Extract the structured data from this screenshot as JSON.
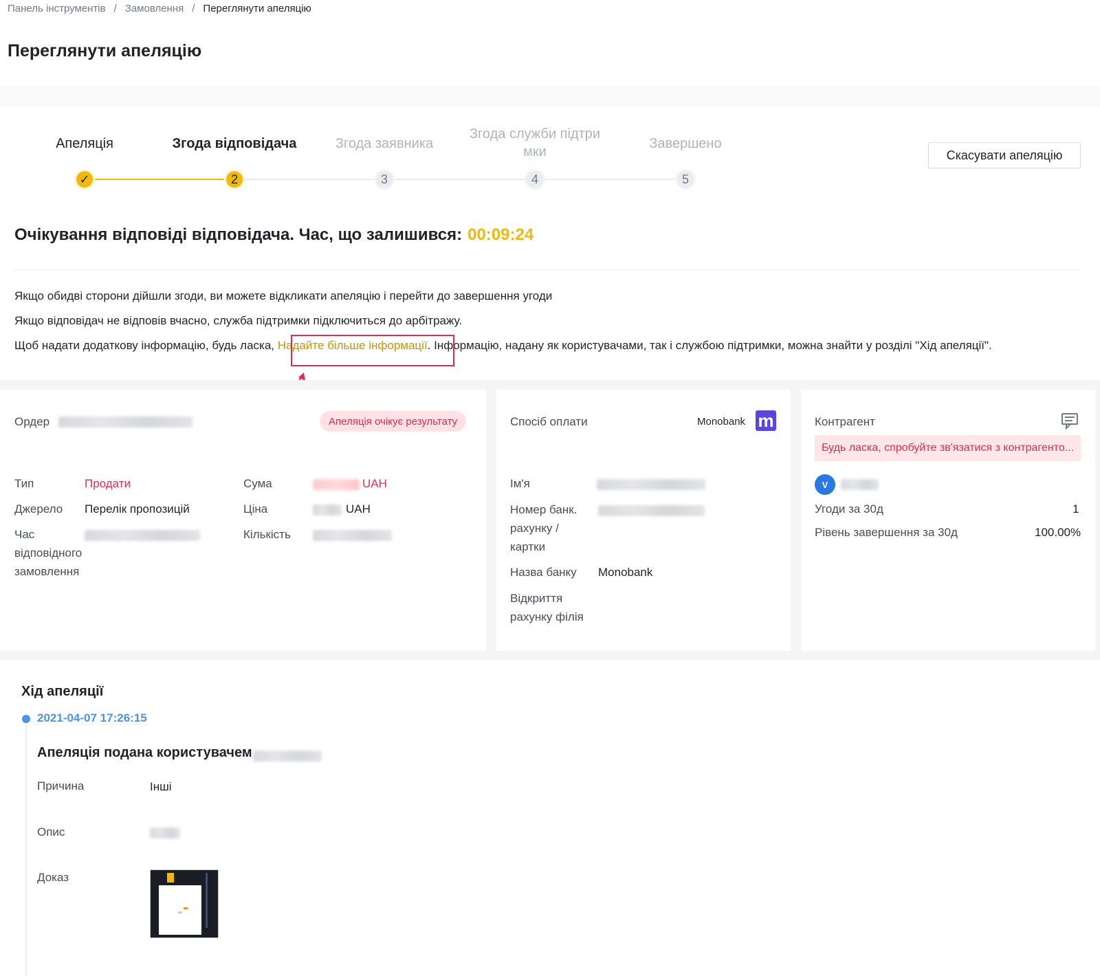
{
  "breadcrumb": {
    "item1": "Панель інструментів",
    "sep": "/",
    "item2": "Замовлення",
    "item3": "Переглянути апеляцію"
  },
  "page_title": "Переглянути апеляцію",
  "steps": [
    {
      "label": "Апеляція",
      "state": "done",
      "number": "✓"
    },
    {
      "label": "Згода відповідача",
      "state": "active",
      "number": "2"
    },
    {
      "label": "Згода заявника",
      "state": "pending",
      "number": "3"
    },
    {
      "label": "Згода служби підтри мки",
      "state": "pending",
      "number": "4"
    },
    {
      "label": "Завершено",
      "state": "pending",
      "number": "5"
    }
  ],
  "cancel_button": "Скасувати апеляцію",
  "waiting": {
    "text": "Очікування відповіді відповідача. Час, що залишився:",
    "timer": "00:09:24"
  },
  "info": {
    "line1": "Якщо обидві сторони дійшли згоди, ви можете відкликати апеляцію і перейти до завершення угоди",
    "line2": "Якщо відповідач не відповів вчасно, служба підтримки підключиться до арбітражу.",
    "line3_pre": "Щоб надати додаткову інформацію, будь ласка, ",
    "line3_link": "Надайте більше інформації",
    "line3_post": ". Інформацію, надану як користувачами, так і службою підтримки, можна знайти у розділі \"Хід апеляції\"."
  },
  "order": {
    "label": "Ордер",
    "status_badge": "Апеляція очікує результату",
    "type_label": "Тип",
    "type_value": "Продати",
    "source_label": "Джерело",
    "source_value": "Перелік пропозицій",
    "time_label": "Час відповідного замовлення",
    "sum_label": "Сума",
    "sum_currency": "UAH",
    "price_label": "Ціна",
    "price_currency": "UAH",
    "qty_label": "Кількість"
  },
  "payment": {
    "label": "Спосіб оплати",
    "method": "Monobank",
    "logo_letter": "m",
    "name_label": "Ім'я",
    "account_label": "Номер банк. рахунку / картки",
    "bank_label": "Назва банку",
    "bank_value": "Monobank",
    "branch_label": "Відкриття рахунку філія"
  },
  "counterparty": {
    "label": "Контрагент",
    "warning": "Будь ласка, спробуйте зв'язатися з контрагенто...",
    "avatar_letter": "V",
    "deals_label": "Угоди за 30д",
    "deals_value": "1",
    "completion_label": "Рівень завершення за 30д",
    "completion_value": "100.00%"
  },
  "progress": {
    "title": "Хід апеляції",
    "date": "2021-04-07 17:26:15",
    "heading": "Апеляція подана користувачем",
    "reason_label": "Причина",
    "reason_value": "Інші",
    "desc_label": "Опис",
    "proof_label": "Доказ"
  },
  "colors": {
    "accent": "#f0b90b",
    "danger": "#d9304e",
    "link": "#c99400",
    "timeline": "#4d93e8"
  }
}
